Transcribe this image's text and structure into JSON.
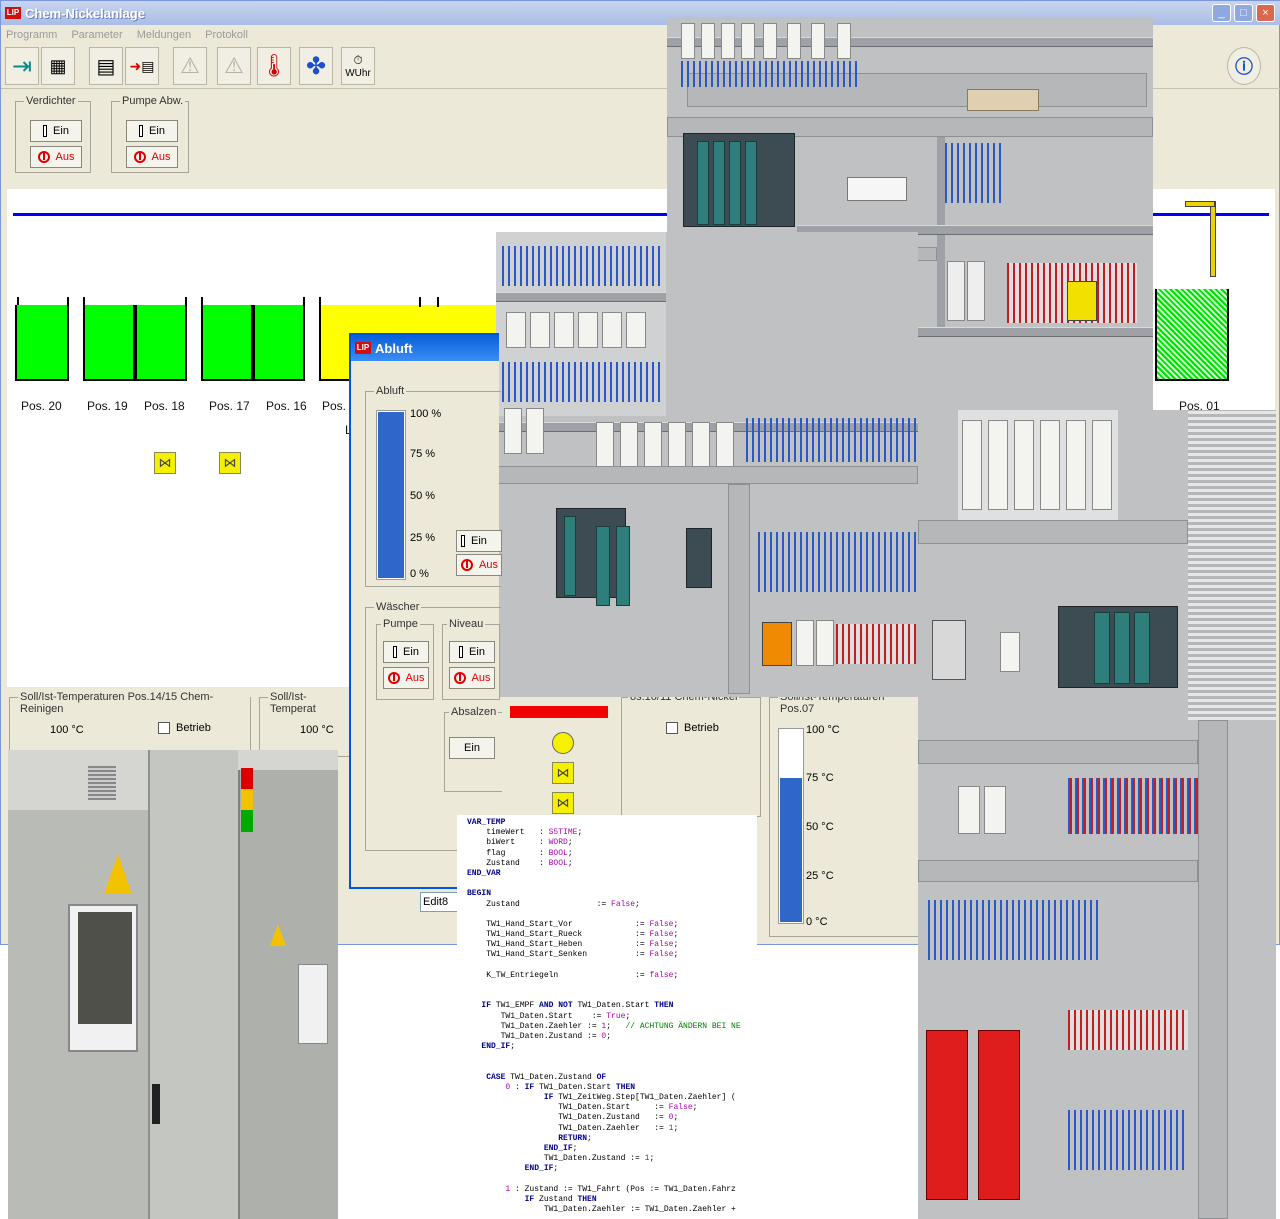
{
  "window": {
    "title": "Chem-Nickelanlage",
    "logo": "LIP"
  },
  "menu": [
    "Programm",
    "Parameter",
    "Meldungen",
    "Protokoll"
  ],
  "toolbar": {
    "items": [
      "exit-icon",
      "panel-icon",
      "document-icon",
      "arrow-document-icon",
      "warning-icon",
      "warning-icon",
      "thermometer-icon",
      "fan-icon"
    ],
    "wuhr_label": "WUhr"
  },
  "switch_groups": [
    {
      "label": "Verdichter",
      "on": "Ein",
      "off": "Aus"
    },
    {
      "label": "Pumpe Abw.",
      "on": "Ein",
      "off": "Aus"
    }
  ],
  "tanks": {
    "positions": [
      "Pos. 20",
      "Pos. 19",
      "Pos. 18",
      "Pos. 17",
      "Pos. 16",
      "Pos. 1",
      "Pos. 01"
    ],
    "partial_label": "L",
    "colors": {
      "full": "#00ff00",
      "warn": "#ffff00",
      "line": "#0000ff"
    }
  },
  "bottom_groups": [
    {
      "label": "Soll/Ist-Temperaturen Pos.14/15 Chem-Reinigen",
      "tick": "100 °C",
      "betrieb": "Betrieb"
    },
    {
      "label": "Soll/Ist-Temperat",
      "tick": "100 °C"
    },
    {
      "label": "os.10/11 Chem-Nickel",
      "betrieb": "Betrieb"
    },
    {
      "label": "Soll/Ist-Temperaturen Pos.07",
      "ticks": [
        "100 °C",
        "75 °C",
        "50 °C",
        "25 °C",
        "0 °C"
      ],
      "level_pct": 75
    }
  ],
  "dialog": {
    "title": "Abluft",
    "abluft_group": "Abluft",
    "scale": [
      "100 %",
      "75  %",
      "50  %",
      "25  %",
      "0  %"
    ],
    "level_pct": 100,
    "side_on": "Ein",
    "side_off": "Aus",
    "waescher_group": "Wäscher",
    "pumpe": {
      "label": "Pumpe",
      "on": "Ein",
      "off": "Aus"
    },
    "niveau": {
      "label": "Niveau",
      "on": "Ein",
      "off": "Aus"
    },
    "absalz": {
      "label": "Absalzen",
      "on": "Ein"
    },
    "edit_value": "Edit8"
  },
  "code_lines": [
    "VAR_TEMP",
    "    timeWert   : S5TIME;",
    "    biWert     : WORD;",
    "    flag       : BOOL;",
    "    Zustand    : BOOL;",
    "END_VAR",
    "",
    "BEGIN",
    "    Zustand                := False;",
    "",
    "    TW1_Hand_Start_Vor             := False;",
    "    TW1_Hand_Start_Rueck           := False;",
    "    TW1_Hand_Start_Heben           := False;",
    "    TW1_Hand_Start_Senken          := False;",
    "",
    "    K_TW_Entriegeln                := false;",
    "",
    "",
    "   IF TW1_EMPF AND NOT TW1_Daten.Start THEN",
    "       TW1_Daten.Start    := True;",
    "       TW1_Daten.Zaehler := 1;   // ACHTUNG ÄNDERN BEI NE",
    "       TW1_Daten.Zustand := 0;",
    "   END_IF;",
    "",
    "",
    "    CASE TW1_Daten.Zustand OF",
    "        0 : IF TW1_Daten.Start THEN",
    "                IF TW1_ZeitWeg.Step[TW1_Daten.Zaehler] (",
    "                   TW1_Daten.Start     := False;",
    "                   TW1_Daten.Zustand   := 0;",
    "                   TW1_Daten.Zaehler   := 1;",
    "                   RETURN;",
    "                END_IF;",
    "                TW1_Daten.Zustand := 1;",
    "            END_IF;",
    "",
    "        1 : Zustand := TW1_Fahrt (Pos := TW1_Daten.Fahrz",
    "            IF Zustand THEN",
    "                TW1_Daten.Zaehler := TW1_Daten.Zaehler +"
  ],
  "photos": [
    "control-cabinet-top-photo",
    "control-cabinet-middle-photo",
    "control-cabinet-right-photo",
    "cabinet-row-photo"
  ]
}
